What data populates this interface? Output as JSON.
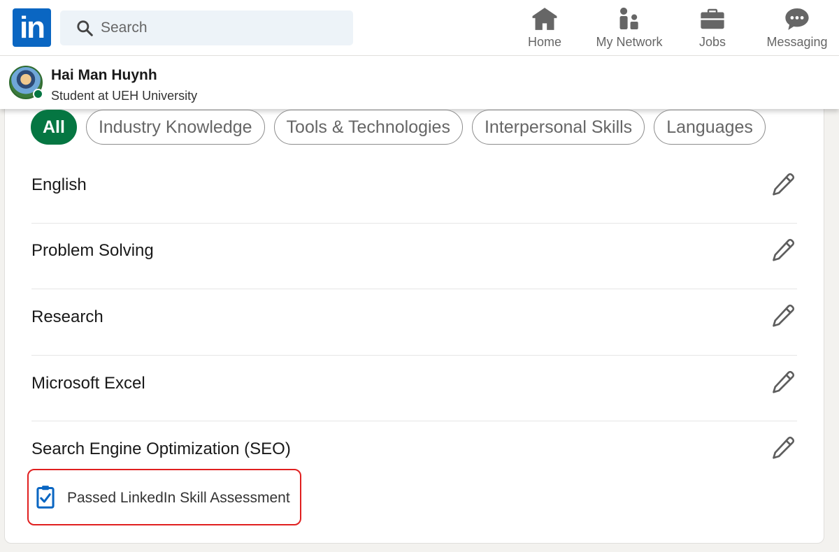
{
  "nav": {
    "logo_text": "in",
    "search_placeholder": "Search",
    "items": [
      {
        "label": "Home",
        "icon": "home-icon"
      },
      {
        "label": "My Network",
        "icon": "network-icon"
      },
      {
        "label": "Jobs",
        "icon": "briefcase-icon"
      },
      {
        "label": "Messaging",
        "icon": "message-icon"
      }
    ]
  },
  "profile": {
    "name": "Hai Man Huynh",
    "headline": "Student at UEH University",
    "status": "online"
  },
  "filters": [
    {
      "label": "All",
      "active": true
    },
    {
      "label": "Industry Knowledge",
      "active": false
    },
    {
      "label": "Tools & Technologies",
      "active": false
    },
    {
      "label": "Interpersonal Skills",
      "active": false
    },
    {
      "label": "Languages",
      "active": false
    }
  ],
  "skills": [
    {
      "name": "English"
    },
    {
      "name": "Problem Solving"
    },
    {
      "name": "Research"
    },
    {
      "name": "Microsoft Excel"
    },
    {
      "name": "Search Engine Optimization (SEO)"
    }
  ],
  "assessment_badge": {
    "text": "Passed LinkedIn Skill Assessment",
    "icon": "clipboard-check-icon"
  },
  "colors": {
    "brand": "#0a66c2",
    "active_pill": "#057642",
    "highlight_border": "#e02020"
  }
}
